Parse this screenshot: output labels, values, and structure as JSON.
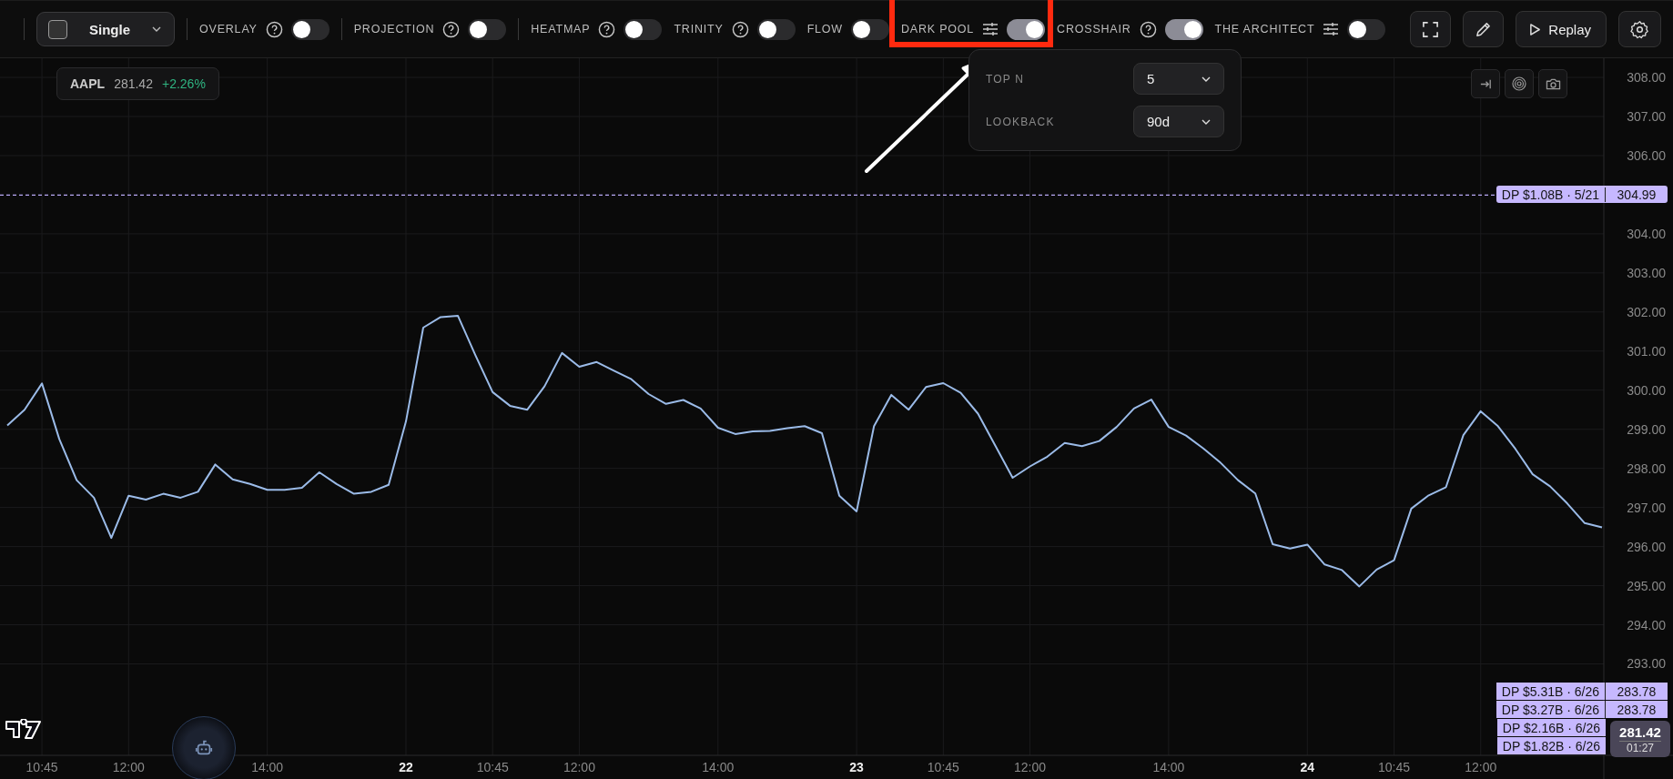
{
  "toolbar": {
    "layout_button": {
      "label": "Single"
    },
    "toggles": [
      {
        "label": "OVERLAY",
        "kind": "help",
        "on": false,
        "separated": true
      },
      {
        "label": "PROJECTION",
        "kind": "help",
        "on": false,
        "separated": true
      },
      {
        "label": "HEATMAP",
        "kind": "help",
        "on": false,
        "separated": false
      },
      {
        "label": "TRINITY",
        "kind": "help",
        "on": false,
        "separated": false
      },
      {
        "label": "FLOW",
        "kind": "plain",
        "on": false,
        "separated": false
      },
      {
        "label": "DARK POOL",
        "kind": "sliders",
        "on": true,
        "separated": false
      },
      {
        "label": "CROSSHAIR",
        "kind": "help",
        "on": true,
        "separated": false
      },
      {
        "label": "THE ARCHITECT",
        "kind": "sliders",
        "on": false,
        "separated": false
      }
    ],
    "actions": [
      {
        "kind": "fullscreen"
      },
      {
        "kind": "draw"
      },
      {
        "kind": "replay",
        "label": "Replay"
      },
      {
        "kind": "settings"
      }
    ]
  },
  "ticker": {
    "symbol": "AAPL",
    "price": "281.42",
    "change": "+2.26%"
  },
  "dark_pool_popup": {
    "rows": [
      {
        "label": "TOP N",
        "value": "5"
      },
      {
        "label": "LOOKBACK",
        "value": "90d"
      }
    ]
  },
  "chart_tools": [
    {
      "kind": "jump"
    },
    {
      "kind": "target"
    },
    {
      "kind": "camera"
    }
  ],
  "chart": {
    "chart_data": {
      "type": "line",
      "ylim": [
        290.66,
        308.49
      ],
      "yticks": [
        {
          "value": 293,
          "label": "293.00"
        },
        {
          "value": 294,
          "label": "294.00"
        },
        {
          "value": 295,
          "label": "295.00"
        },
        {
          "value": 296,
          "label": "296.00"
        },
        {
          "value": 297,
          "label": "297.00"
        },
        {
          "value": 298,
          "label": "298.00"
        },
        {
          "value": 299,
          "label": "299.00"
        },
        {
          "value": 300,
          "label": "300.00"
        },
        {
          "value": 301,
          "label": "301.00"
        },
        {
          "value": 302,
          "label": "302.00"
        },
        {
          "value": 303,
          "label": "303.00"
        },
        {
          "value": 304,
          "label": "304.00"
        },
        {
          "value": 306,
          "label": "306.00"
        },
        {
          "value": 307,
          "label": "307.00"
        },
        {
          "value": 308,
          "label": "308.00"
        }
      ],
      "categories": [
        null,
        null,
        "10:45",
        null,
        null,
        null,
        null,
        "12:00",
        null,
        null,
        null,
        null,
        null,
        null,
        null,
        "14:00",
        null,
        null,
        null,
        null,
        null,
        null,
        null,
        "22",
        null,
        null,
        null,
        null,
        "10:45",
        null,
        null,
        null,
        null,
        "12:00",
        null,
        null,
        null,
        null,
        null,
        null,
        null,
        "14:00",
        null,
        null,
        null,
        null,
        null,
        null,
        null,
        "23",
        null,
        null,
        null,
        null,
        "10:45",
        null,
        null,
        null,
        null,
        "12:00",
        null,
        null,
        null,
        null,
        null,
        null,
        null,
        "14:00",
        null,
        null,
        null,
        null,
        null,
        null,
        null,
        "24",
        null,
        null,
        null,
        null,
        "10:45",
        null,
        null,
        null,
        null,
        "12:00",
        null,
        null,
        null,
        null,
        null,
        null,
        null
      ],
      "values": [
        299.1,
        299.5,
        300.17,
        298.75,
        297.7,
        297.25,
        296.22,
        297.3,
        297.2,
        297.35,
        297.25,
        297.4,
        298.1,
        297.72,
        297.6,
        297.45,
        297.45,
        297.5,
        297.9,
        297.6,
        297.35,
        297.4,
        297.58,
        299.2,
        301.6,
        301.87,
        301.9,
        300.9,
        299.95,
        299.6,
        299.5,
        300.1,
        300.95,
        300.6,
        300.72,
        300.5,
        300.28,
        299.9,
        299.65,
        299.75,
        299.53,
        299.04,
        298.88,
        298.95,
        298.96,
        299.03,
        299.08,
        298.9,
        297.3,
        296.9,
        299.08,
        299.88,
        299.5,
        300.08,
        300.18,
        299.93,
        299.4,
        298.58,
        297.76,
        298.05,
        298.3,
        298.65,
        298.57,
        298.7,
        299.06,
        299.53,
        299.76,
        299.06,
        298.84,
        298.51,
        298.14,
        297.7,
        297.36,
        296.06,
        295.95,
        296.05,
        295.54,
        295.4,
        294.98,
        295.41,
        295.65,
        296.97,
        297.31,
        297.52,
        298.85,
        299.46,
        299.08,
        298.5,
        297.85,
        297.54,
        297.1,
        296.6,
        296.49
      ],
      "grid": true,
      "ref_lines": [
        {
          "axis": "y",
          "value": 304.99
        }
      ]
    }
  },
  "dark_pool_tags": [
    {
      "text": "DP $1.08B · 5/21",
      "price": "304.99"
    }
  ],
  "offscale_dark_pool_tags": [
    {
      "text": "DP $5.31B · 6/26",
      "price": "283.78"
    },
    {
      "text": "DP $3.27B · 6/26",
      "price": "283.78"
    },
    {
      "text": "DP $2.16B · 6/26"
    },
    {
      "text": "DP $1.82B · 6/26"
    }
  ],
  "current_price": {
    "price": "281.42",
    "countdown": "01:27"
  }
}
